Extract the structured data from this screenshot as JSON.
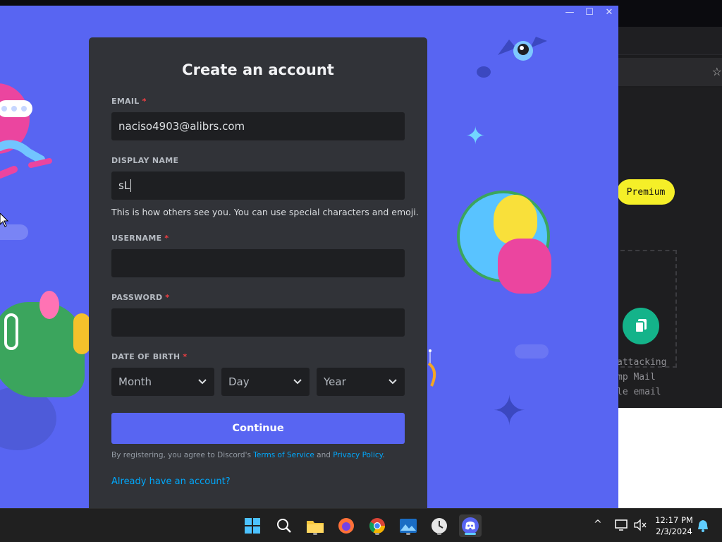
{
  "window": {
    "minimize": "—",
    "maximize": "☐",
    "close": "✕"
  },
  "form": {
    "title": "Create an account",
    "email": {
      "label": "EMAIL",
      "required": "*",
      "value": "naciso4903@alibrs.com"
    },
    "display_name": {
      "label": "DISPLAY NAME",
      "value": "sL",
      "help": "This is how others see you. You can use special characters and emoji."
    },
    "username": {
      "label": "USERNAME",
      "required": "*",
      "value": ""
    },
    "password": {
      "label": "PASSWORD",
      "required": "*",
      "value": ""
    },
    "dob": {
      "label": "DATE OF BIRTH",
      "required": "*",
      "month": "Month",
      "day": "Day",
      "year": "Year"
    },
    "continue": "Continue",
    "legal": {
      "prefix": "By registering, you agree to Discord's ",
      "tos": "Terms of Service",
      "and": " and ",
      "privacy": "Privacy Policy",
      "suffix": "."
    },
    "login_link": "Already have an account?"
  },
  "background_app": {
    "star": "☆",
    "premium": "Premium",
    "lines": [
      "attacking",
      "mp Mail",
      "le email"
    ]
  },
  "taskbar": {
    "icons": [
      "windows-start-icon",
      "search-icon",
      "file-explorer-icon",
      "firefox-icon",
      "chrome-icon",
      "photos-icon",
      "clock-app-icon",
      "discord-icon"
    ],
    "time": "12:17 PM",
    "date": "2/3/2024",
    "chevron": "^"
  },
  "colors": {
    "discord_blurple": "#5865f2",
    "card": "#313338",
    "input": "#1e1f22",
    "link": "#00a8fc",
    "required": "#f23f43",
    "premium": "#f5ef28"
  }
}
